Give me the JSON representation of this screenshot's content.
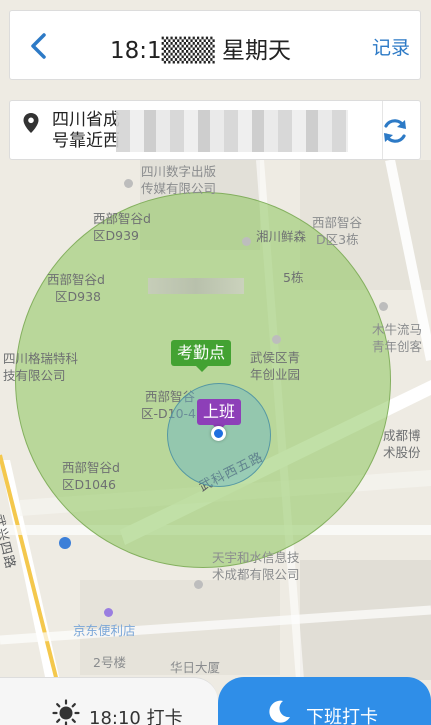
{
  "header": {
    "title": "18:1▒▒▒ 星期天",
    "record_label": "记录",
    "back_icon": "chevron-left-icon"
  },
  "address": {
    "line1": "四川省成",
    "line2": "号靠近西",
    "refresh_icon": "refresh-icon"
  },
  "map": {
    "labels": [
      "四川数字出版",
      "传媒有限公司",
      "西部智谷d",
      "区D939",
      "西部智谷d",
      "区D938",
      "湘川鲜森",
      "西部智谷",
      "D区3栋",
      "5栋",
      "四川格瑞特科",
      "技有限公司",
      "武侯区青",
      "年创业园",
      "木牛流马",
      "青年创客",
      "西部智谷",
      "区-D10-4",
      "成都博",
      "术股份",
      "西部智谷d",
      "区D1046",
      "天宇和水信息技",
      "术成都有限公司",
      "京东便利店",
      "2号楼",
      "华日大厦"
    ],
    "road_labels": [
      "武科西五路",
      "武兴四路"
    ],
    "marker_attendance": "考勤点",
    "marker_work": "上班",
    "colors": {
      "attendance_radius": "#8ec65e",
      "current_radius": "#69b4c8",
      "attendance_marker": "#43a232",
      "work_marker": "#8d3fb8",
      "location_dot": "#1f6fe0"
    }
  },
  "bottom": {
    "checkin_label": "18:10 打卡",
    "checkout_label": "下班打卡",
    "checkin_icon": "sun-icon",
    "checkout_icon": "moon-icon",
    "accent": "#2f8ee8"
  }
}
